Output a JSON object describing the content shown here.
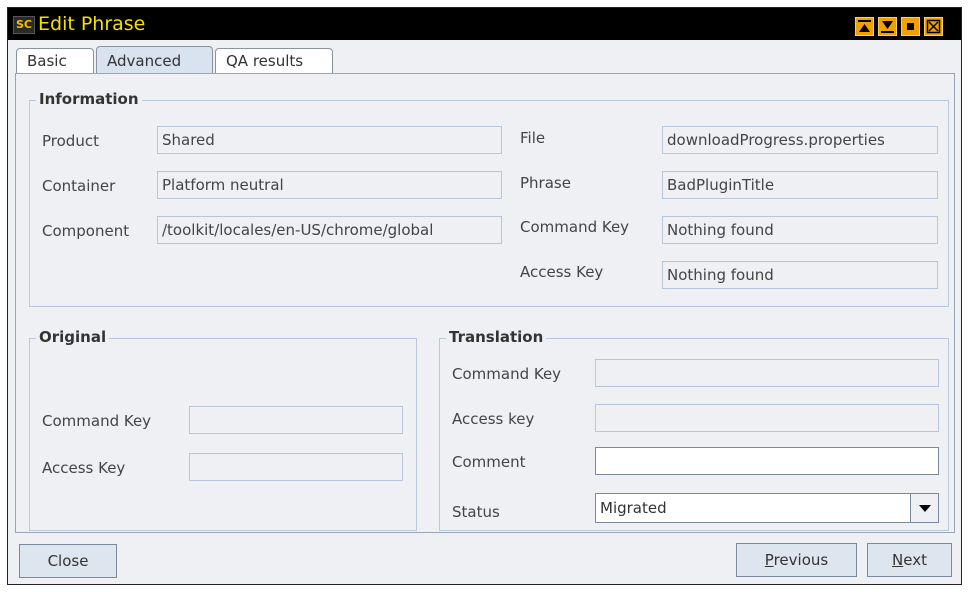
{
  "window": {
    "title": "Edit Phrase",
    "app_icon_text": "SC"
  },
  "tabs": [
    {
      "label": "Basic"
    },
    {
      "label": "Advanced"
    },
    {
      "label": "QA results"
    }
  ],
  "information": {
    "title": "Information",
    "product_label": "Product",
    "product_value": "Shared",
    "container_label": "Container",
    "container_value": "Platform neutral",
    "component_label": "Component",
    "component_value": "/toolkit/locales/en-US/chrome/global",
    "file_label": "File",
    "file_value": "downloadProgress.properties",
    "phrase_label": "Phrase",
    "phrase_value": "BadPluginTitle",
    "command_key_label": "Command Key",
    "command_key_value": "Nothing found",
    "access_key_label": "Access Key",
    "access_key_value": "Nothing found"
  },
  "original": {
    "title": "Original",
    "command_key_label": "Command Key",
    "command_key_value": "",
    "access_key_label": "Access Key",
    "access_key_value": ""
  },
  "translation": {
    "title": "Translation",
    "command_key_label": "Command Key",
    "command_key_value": "",
    "access_key_label": "Access key",
    "access_key_value": "",
    "comment_label": "Comment",
    "comment_value": "",
    "status_label": "Status",
    "status_value": "Migrated"
  },
  "buttons": {
    "close": "Close",
    "previous_mnemonic": "P",
    "previous_rest": "revious",
    "next_mnemonic": "N",
    "next_rest": "ext"
  },
  "colors": {
    "titlebar_bg": "#000000",
    "title_text": "#f5e000",
    "window_button": "#f0a000",
    "panel_bg": "#eef0f4"
  },
  "icons": {
    "app": "sc-logo-icon",
    "minimize": "minimize-icon",
    "maximize": "maximize-icon",
    "restore": "restore-icon",
    "close": "close-icon",
    "dropdown": "chevron-down-icon"
  }
}
